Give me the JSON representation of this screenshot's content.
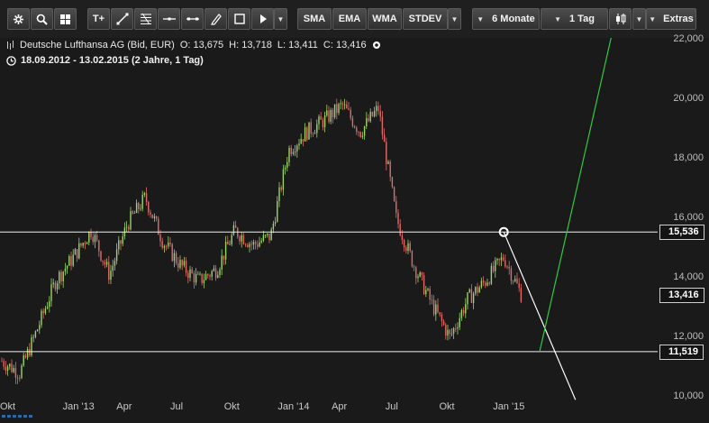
{
  "toolbar": {
    "settings_icon": "gear-icon",
    "zoom_icon": "search-icon",
    "layout_icon": "grid-icon",
    "text_tool_label": "T+",
    "sma_label": "SMA",
    "ema_label": "EMA",
    "wma_label": "WMA",
    "stdev_label": "STDEV",
    "period_label": "6 Monate",
    "interval_label": "1 Tag",
    "extras_label": "Extras"
  },
  "header": {
    "instrument": "Deutsche Lufthansa AG (Bid, EUR)",
    "open": "O: 13,675",
    "high": "H: 13,718",
    "low": "L: 13,411",
    "close": "C: 13,416",
    "range": "18.09.2012 - 13.02.2015 (2 Jahre, 1 Tag)"
  },
  "chart_data": {
    "type": "candlestick",
    "instrument": "Deutsche Lufthansa AG (Bid, EUR)",
    "date_range": [
      "2012-09-18",
      "2015-02-13"
    ],
    "y_axis": {
      "range": [
        9.9,
        22.1
      ],
      "ticks": [
        "10,000",
        "12,000",
        "14,000",
        "16,000",
        "18,000",
        "20,000",
        "22,000"
      ],
      "side": "right"
    },
    "x_axis": {
      "ticks": [
        "Okt",
        "Jan '13",
        "Apr",
        "Jul",
        "Okt",
        "Jan '14",
        "Apr",
        "Jul",
        "Okt",
        "Jan '15"
      ]
    },
    "close_series": {
      "x": [
        "2012-09",
        "2012-10",
        "2012-11",
        "2012-12",
        "2013-01",
        "2013-02",
        "2013-03",
        "2013-04",
        "2013-05",
        "2013-06",
        "2013-07",
        "2013-08",
        "2013-09",
        "2013-10",
        "2013-11",
        "2013-12",
        "2014-01",
        "2014-02",
        "2014-03",
        "2014-04",
        "2014-05",
        "2014-06",
        "2014-07",
        "2014-08",
        "2014-09",
        "2014-10",
        "2014-11",
        "2014-12",
        "2015-01",
        "2015-02"
      ],
      "y": [
        11.2,
        10.8,
        12.3,
        13.9,
        14.7,
        15.6,
        14.1,
        15.8,
        16.7,
        15.2,
        14.4,
        13.9,
        14.3,
        15.6,
        15.1,
        15.4,
        18.3,
        18.9,
        19.3,
        19.8,
        18.9,
        19.7,
        16.0,
        14.4,
        13.1,
        12.0,
        13.3,
        13.9,
        14.7,
        13.4
      ]
    },
    "horizontal_lines": [
      15.536,
      11.519
    ],
    "price_labels": [
      "15,536",
      "11,519",
      "13,416"
    ],
    "last_price": 13.416,
    "marked_point": {
      "date": "2015-01",
      "value": 15.536
    },
    "trend_lines": [
      {
        "color": "#ffffff",
        "from": {
          "date": "2015-01",
          "value": 15.536
        },
        "to": {
          "date": "2015-05",
          "value": 9.9
        }
      },
      {
        "color": "#2ecc40",
        "from": {
          "date": "2015-03",
          "value": 11.519
        },
        "to": {
          "date": "2015-07",
          "value": 22.1
        }
      }
    ],
    "candle_colors": {
      "up": "#9bd468",
      "down": "#e06a6a"
    },
    "grid": false
  }
}
